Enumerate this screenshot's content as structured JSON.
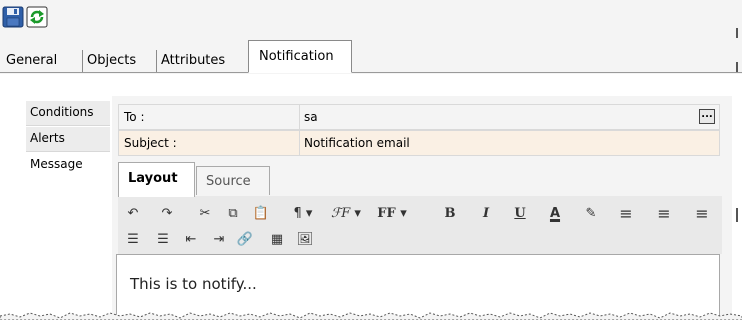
{
  "toolbar": {
    "save_icon": "save-icon",
    "refresh_icon": "refresh-icon"
  },
  "tabs": [
    {
      "label": "General",
      "active": false
    },
    {
      "label": "Objects",
      "active": false
    },
    {
      "label": "Attributes",
      "active": false
    },
    {
      "label": "Notification",
      "active": true
    }
  ],
  "sidebar": {
    "items": [
      {
        "label": "Conditions",
        "active": false
      },
      {
        "label": "Alerts",
        "active": false
      },
      {
        "label": "Message",
        "active": true
      }
    ]
  },
  "form": {
    "to": {
      "label": "To :",
      "value": "sa",
      "button": "..."
    },
    "subject": {
      "label": "Subject :",
      "value": "Notification email"
    }
  },
  "editor": {
    "tabs": [
      {
        "label": "Layout",
        "active": true
      },
      {
        "label": "Source",
        "active": false
      }
    ],
    "toolbar_row1": [
      {
        "icon": "undo-icon",
        "glyph": "↶"
      },
      {
        "icon": "redo-icon",
        "glyph": "↷"
      },
      {
        "icon": "cut-icon",
        "glyph": "✂"
      },
      {
        "icon": "copy-icon",
        "glyph": "⧉"
      },
      {
        "icon": "paste-icon",
        "glyph": "📋"
      },
      {
        "icon": "paragraph-icon",
        "glyph": "¶ ▾"
      },
      {
        "icon": "font-family-icon",
        "glyph": "ℱF ▾"
      },
      {
        "icon": "font-size-icon",
        "glyph": "FF ▾"
      },
      {
        "icon": "bold-icon",
        "glyph": "B"
      },
      {
        "icon": "italic-icon",
        "glyph": "I"
      },
      {
        "icon": "underline-icon",
        "glyph": "U"
      },
      {
        "icon": "font-color-icon",
        "glyph": "A"
      },
      {
        "icon": "highlight-icon",
        "glyph": "✎"
      },
      {
        "icon": "align-left-icon",
        "glyph": "≡"
      },
      {
        "icon": "align-center-icon",
        "glyph": "≡"
      },
      {
        "icon": "align-right-icon",
        "glyph": "≡"
      }
    ],
    "toolbar_row2": [
      {
        "icon": "ordered-list-icon",
        "glyph": "☰"
      },
      {
        "icon": "unordered-list-icon",
        "glyph": "☰"
      },
      {
        "icon": "outdent-icon",
        "glyph": "⇤"
      },
      {
        "icon": "indent-icon",
        "glyph": "⇥"
      },
      {
        "icon": "insert-link-icon",
        "glyph": "🔗"
      },
      {
        "icon": "insert-table-icon",
        "glyph": "▦"
      },
      {
        "icon": "insert-image-icon",
        "glyph": "🖼"
      }
    ],
    "content": "This is to notify..."
  },
  "colors": {
    "panel_bg": "#f4f4f4",
    "border": "#8a8a8a",
    "label_bg": "#faf0e4"
  }
}
